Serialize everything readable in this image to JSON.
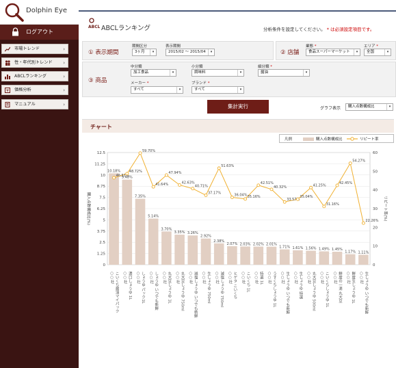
{
  "app": {
    "name": "Dolphin Eye",
    "logout": "ログアウト"
  },
  "sidebar": {
    "items": [
      {
        "label": "市場トレンド",
        "icon": "market-trend-icon"
      },
      {
        "label": "性・年代別トレンド",
        "icon": "gender-age-icon"
      },
      {
        "label": "ABCLランキング",
        "icon": "abcl-ranking-icon"
      },
      {
        "label": "価格分析",
        "icon": "price-analysis-icon"
      },
      {
        "label": "マニュアル",
        "icon": "manual-icon"
      }
    ]
  },
  "header": {
    "title": "ABCLランキング",
    "note": "分析条件を設定してください。",
    "note_required": "* は必須設定項目です。"
  },
  "period": {
    "section": "① 表示期間",
    "unit_label": "期間区分",
    "unit_value": "3ヶ月",
    "range_label": "表示期間",
    "range_value": "2015/02 ～ 2015/04"
  },
  "store": {
    "section": "② 店舗",
    "type_label": "業態",
    "type_value": "食品スーパーマーケット",
    "area_label": "エリア",
    "area_value": "全国"
  },
  "product": {
    "section": "③ 商品",
    "mid_label": "中分類",
    "mid_value": "加工食品",
    "small_label": "小分類",
    "small_value": "調味料",
    "detail_label": "細分類",
    "detail_value": "醤油",
    "maker_label": "メーカー",
    "maker_value": "すべて",
    "brand_label": "ブランド",
    "brand_value": "すべて"
  },
  "actions": {
    "exec": "集計実行",
    "graph_label": "グラフ表示",
    "graph_value": "購入点数構成比"
  },
  "chart_section": {
    "title": "チャート"
  },
  "colors": {
    "bar": "#e2cfc3",
    "line": "#f0b030",
    "brand": "#6e1d17",
    "sidebar": "#3a1412"
  },
  "chart_data": {
    "type": "bar+line",
    "legend": {
      "title": "凡例",
      "series": [
        "購入点数構成比",
        "リピート率"
      ]
    },
    "ylabel": "購入点数構成比(%)",
    "y2label": "リピート率(%)",
    "ylim": [
      0,
      12.5
    ],
    "y2lim": [
      0,
      60
    ],
    "yticks": [
      "12.5",
      "11.25",
      "10",
      "8.75",
      "7.5",
      "6.25",
      "5",
      "3.75",
      "2.5",
      "1.25",
      "0"
    ],
    "y2ticks": [
      "60",
      "50",
      "40",
      "30",
      "20",
      "10",
      "0"
    ],
    "categories": [
      "○○社 こいくち醤油 マイパック",
      "濃口しょうゆ 1L",
      "○○社 しょうゆ パック 1L",
      "○○社 しょうゆ いつでも新鮮",
      "○○社 丸大豆しょうゆ 1L",
      "○○社 丸大豆しょうゆ 750ml",
      "○○社 減塩しょうゆ いつでも新鮮",
      "○○社 生しょうゆ 750ml",
      "○○社 減塩しょうゆ 750ml",
      "○○社 ヒゲタ こいくち",
      "○○社 こいくち 1L",
      "○○社 特選 1L",
      "○○社 うすくちしょうゆ 1L",
      "○○社 生しょうゆ いつでも新鮮",
      "○○社 生しょうゆ 特選",
      "○○社 丸大豆しょうゆ 500ml",
      "○○社 こいくちしょうゆ 1L",
      "○○社 鮮度の一滴 丸大豆しょうゆ",
      "○○社 鮮度生しょうゆ 1L",
      "○○社 生しょうゆ いつでも新鮮"
    ],
    "cat_labels": [
      "○○社\nこいくち醤油マイパック",
      "○○社\n濃口しょうゆ 1L",
      "○○社\nしょうゆ パック1L",
      "○○社\nしょうゆ いつでも新鮮",
      "○○社\n丸大豆しょうゆ 1L",
      "○○社\n丸大豆しょうゆ 750ml",
      "○○社\n減塩しょうゆ いつでも新鮮",
      "○○社\n生しょうゆ 750ml",
      "○○社\n減塩しょうゆ 750ml",
      "○○社\nヒゲタ こいくち",
      "○○社\nこいくち 1L",
      "○○社\n特選 1L",
      "○○社\nうすくちしょうゆ 1L",
      "○○社\n生しょうゆ いつでも新鮮",
      "○○社\n生しょうゆ 特選",
      "○○社\n丸大豆しょうゆ 500ml",
      "○○社\nこいくちしょうゆ 1L",
      "○○社\n鮮度の一滴 丸大豆",
      "○○社\n鮮度生しょうゆ 1L",
      "○○社\n生しょうゆ いつでも新鮮"
    ],
    "bar_values": [
      10.18,
      9.48,
      7.35,
      5.14,
      3.7,
      3.35,
      3.26,
      2.92,
      2.38,
      2.07,
      2.03,
      2.02,
      2.01,
      1.71,
      1.61,
      1.56,
      1.49,
      1.45,
      1.17,
      1.11
    ],
    "bar_labels": [
      "10.18%",
      "9.48%",
      "7.35%",
      "5.14%",
      "3.70%",
      "3.35%",
      "3.26%",
      "2.92%",
      "2.38%",
      "2.07%",
      "2.03%",
      "2.02%",
      "2.01%",
      "1.71%",
      "1.61%",
      "1.56%",
      "1.49%",
      "1.45%",
      "1.17%",
      "1.11%"
    ],
    "line_values": [
      46.51,
      48.72,
      59.7,
      41.64,
      47.94,
      42.63,
      40.71,
      37.17,
      51.63,
      36.04,
      35.16,
      42.51,
      40.32,
      33.57,
      35.04,
      41.25,
      31.16,
      42.45,
      54.27,
      22.26
    ],
    "line_labels": [
      "46.51%",
      "48.72%",
      "59.70%",
      "41.64%",
      "47.94%",
      "42.63%",
      "40.71%",
      "37.17%",
      "51.63%",
      "36.04%",
      "35.16%",
      "42.51%",
      "40.32%",
      "33.57%",
      "35.04%",
      "41.25%",
      "31.16%",
      "42.45%",
      "54.27%",
      "22.26%"
    ]
  }
}
